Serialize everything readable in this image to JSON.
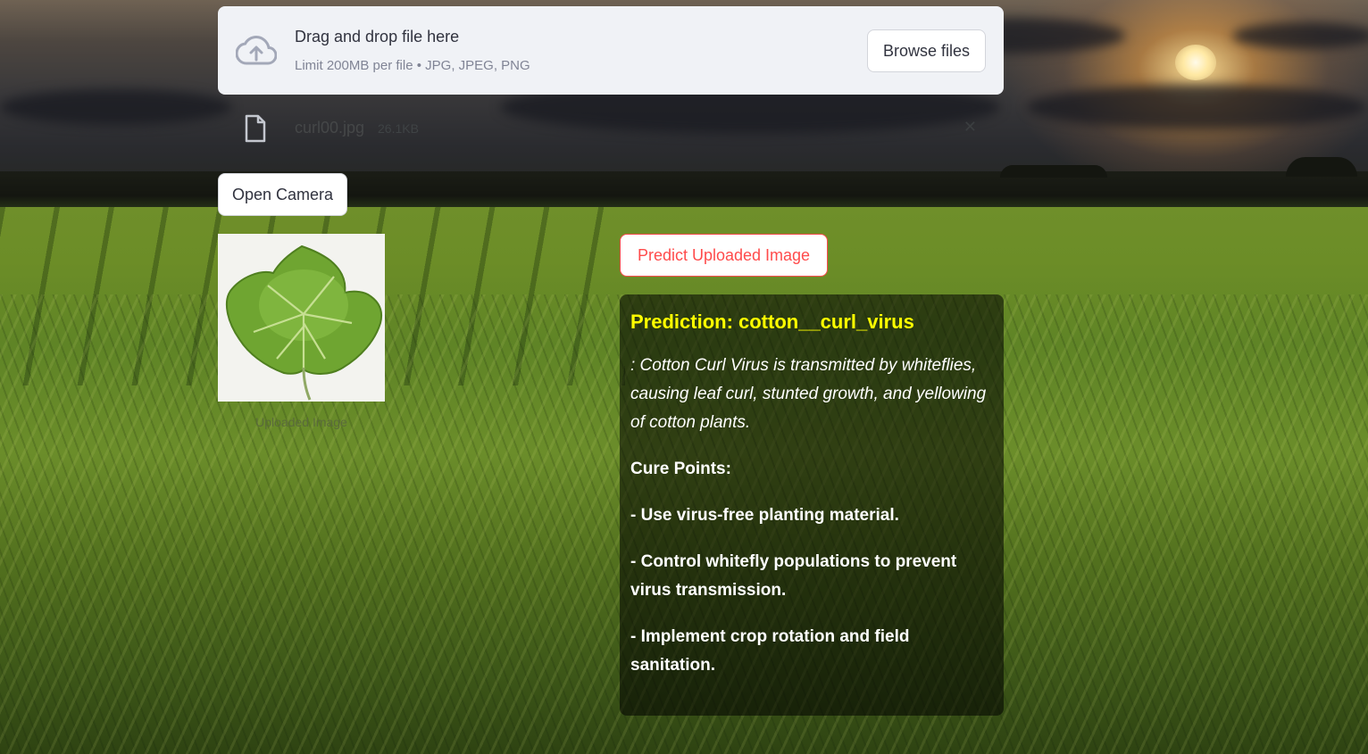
{
  "uploader": {
    "title": "Drag and drop file here",
    "subtitle": "Limit 200MB per file • JPG, JPEG, PNG",
    "browse_label": "Browse files",
    "icon": "cloud-upload-icon"
  },
  "uploaded_file": {
    "name": "curl00.jpg",
    "size": "26.1KB",
    "icon": "file-icon",
    "close_glyph": "✕"
  },
  "camera": {
    "button_label": "Open Camera"
  },
  "image": {
    "caption": "Uploaded Image"
  },
  "predict": {
    "button_label": "Predict Uploaded Image"
  },
  "result": {
    "title": "Prediction: cotton__curl_virus",
    "description": ": Cotton Curl Virus is transmitted by whiteflies, causing leaf curl, stunted growth, and yellowing of cotton plants.",
    "cure_heading": "Cure Points:",
    "cure_points": [
      "- Use virus-free planting material.",
      "- Control whitefly populations to prevent virus transmission.",
      "- Implement crop rotation and field sanitation."
    ]
  },
  "colors": {
    "accent": "#ff4b4b",
    "prediction_title": "#ffff00",
    "uploader_bg": "#f0f2f6"
  }
}
